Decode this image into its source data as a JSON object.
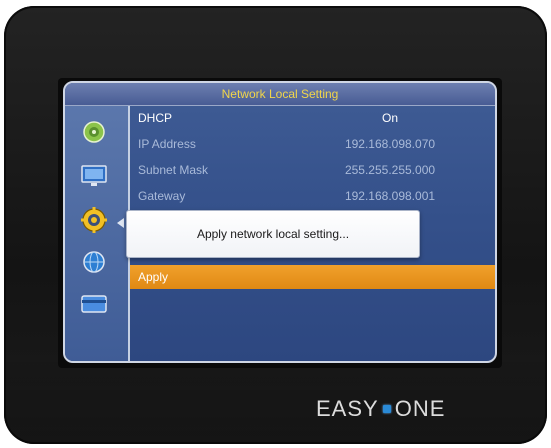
{
  "window": {
    "title": "Network Local Setting"
  },
  "sidebar": {
    "icons": [
      {
        "name": "disc-icon",
        "selected": false
      },
      {
        "name": "monitor-icon",
        "selected": false
      },
      {
        "name": "gear-icon",
        "selected": true
      },
      {
        "name": "globe-icon",
        "selected": false
      },
      {
        "name": "card-icon",
        "selected": false
      }
    ]
  },
  "settings": {
    "dhcp": {
      "label": "DHCP",
      "value": "On"
    },
    "ip_address": {
      "label": "IP Address",
      "value": "192.168.098.070"
    },
    "subnet_mask": {
      "label": "Subnet Mask",
      "value": "255.255.255.000"
    },
    "gateway": {
      "label": "Gateway",
      "value": "192.168.098.001"
    },
    "apply_label": "Apply"
  },
  "dialog": {
    "message": "Apply network local setting..."
  },
  "brand": {
    "left": "EASY",
    "right": "ONE"
  },
  "colors": {
    "accent": "#e8951c",
    "title_text": "#f1d64a",
    "panel": "#3a5690",
    "brand_dot": "#2a8ad6"
  }
}
